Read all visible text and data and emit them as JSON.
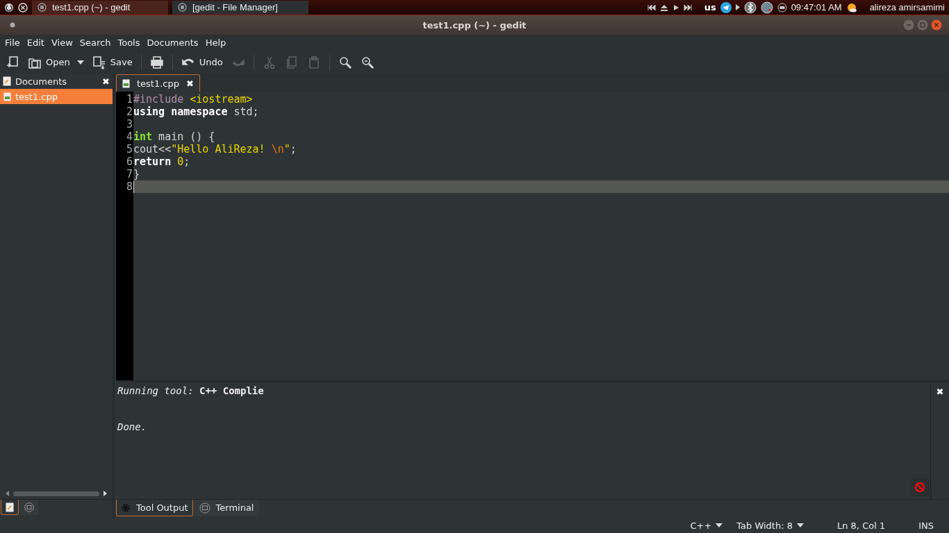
{
  "top_panel": {
    "tasks": [
      {
        "label": "test1.cpp (~) - gedit",
        "selected": true
      },
      {
        "label": "[gedit - File Manager]",
        "selected": false
      }
    ],
    "keyboard_layout": "us",
    "clock": "09:47:01 AM",
    "user": "alireza amirsamimi"
  },
  "window": {
    "title": "test1.cpp (~) - gedit"
  },
  "menu": [
    "File",
    "Edit",
    "View",
    "Search",
    "Tools",
    "Documents",
    "Help"
  ],
  "toolbar": [
    {
      "kind": "new",
      "disabled": false
    },
    {
      "kind": "open",
      "label": "Open",
      "disabled": false
    },
    {
      "kind": "save",
      "label": "Save",
      "disabled": false
    },
    {
      "kind": "separator"
    },
    {
      "kind": "print",
      "disabled": false
    },
    {
      "kind": "separator"
    },
    {
      "kind": "undo",
      "label": "Undo",
      "disabled": false
    },
    {
      "kind": "redo",
      "disabled": true
    },
    {
      "kind": "separator"
    },
    {
      "kind": "cut",
      "disabled": true
    },
    {
      "kind": "copy",
      "disabled": true
    },
    {
      "kind": "paste",
      "disabled": true
    },
    {
      "kind": "separator"
    },
    {
      "kind": "find",
      "disabled": false
    },
    {
      "kind": "replace",
      "disabled": false
    }
  ],
  "side_panel": {
    "title": "Documents",
    "close": "✖",
    "documents": [
      {
        "label": "test1.cpp",
        "selected": true
      }
    ],
    "tabs": [
      {
        "kind": "documents",
        "selected": true
      },
      {
        "kind": "files",
        "selected": false
      }
    ]
  },
  "document_tabs": [
    {
      "label": "test1.cpp",
      "close": "✖",
      "selected": true
    }
  ],
  "editor": {
    "lines": [
      {
        "number": "1",
        "current": false,
        "tokens": [
          {
            "kind": "preproc",
            "text": "#include "
          },
          {
            "kind": "string",
            "text": "<iostream>"
          }
        ]
      },
      {
        "number": "2",
        "current": false,
        "tokens": [
          {
            "kind": "keyword",
            "text": "using namespace"
          },
          {
            "kind": "plain",
            "text": " std;"
          }
        ]
      },
      {
        "number": "3",
        "current": false
      },
      {
        "number": "4",
        "current": false,
        "tokens": [
          {
            "kind": "type",
            "text": "int"
          },
          {
            "kind": "plain",
            "text": " main () {"
          }
        ]
      },
      {
        "number": "5",
        "current": false,
        "tokens": [
          {
            "kind": "plain",
            "text": "cout<<"
          },
          {
            "kind": "string",
            "text": "\"Hello AliReza! "
          },
          {
            "kind": "escape",
            "text": "\\n"
          },
          {
            "kind": "string",
            "text": "\""
          },
          {
            "kind": "plain",
            "text": ";"
          }
        ]
      },
      {
        "number": "6",
        "current": false,
        "tokens": [
          {
            "kind": "keyword",
            "text": "return"
          },
          {
            "kind": "number",
            "text": " 0"
          },
          {
            "kind": "plain",
            "text": ";"
          }
        ]
      },
      {
        "number": "7",
        "current": false,
        "tokens": [
          {
            "kind": "plain",
            "text": "}"
          }
        ]
      },
      {
        "number": "8",
        "current": true
      }
    ]
  },
  "bottom_panel": {
    "close": "✖",
    "output": [
      {
        "kind": "header",
        "text": "*Running tool:* **C++ Complie**"
      },
      {
        "kind": "result",
        "text": "Done."
      }
    ],
    "tabs": [
      {
        "kind": "tool-output",
        "label": "Tool Output",
        "selected": true
      },
      {
        "kind": "terminal",
        "label": "Terminal",
        "selected": false
      }
    ]
  },
  "status_bar": {
    "language": "C++",
    "tab_width": "Tab Width: 8",
    "position": "Ln 8, Col 1",
    "mode": "INS"
  }
}
